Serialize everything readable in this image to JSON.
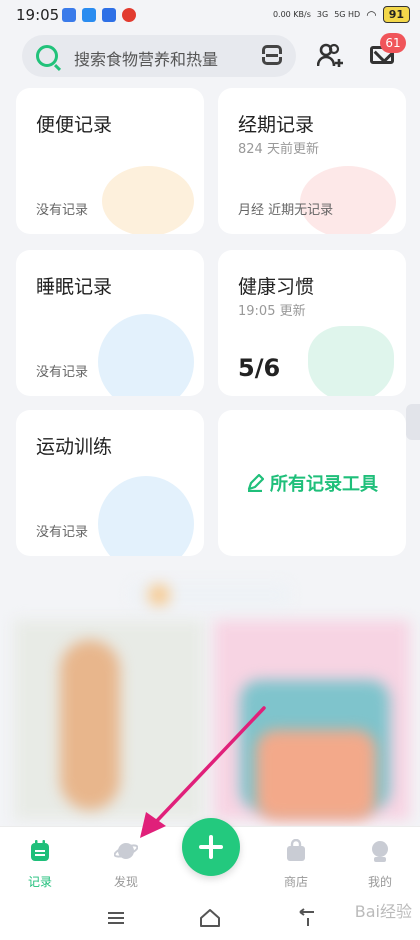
{
  "status": {
    "time": "19:05",
    "battery": "91",
    "net_speed": "0.00 KB/s",
    "signal_3g": "3G",
    "signal_5g": "5G HD"
  },
  "search": {
    "placeholder": "搜索食物营养和热量"
  },
  "mail_badge": "61",
  "cards": [
    {
      "title": "便便记录",
      "foot": "没有记录"
    },
    {
      "title": "经期记录",
      "subtitle": "824 天前更新",
      "foot": "月经 近期无记录"
    },
    {
      "title": "睡眠记录",
      "foot": "没有记录"
    },
    {
      "title": "健康习惯",
      "subtitle": "19:05 更新",
      "value": "5/6"
    },
    {
      "title": "运动训练",
      "foot": "没有记录"
    },
    {
      "title": "所有记录工具"
    }
  ],
  "tabs": [
    {
      "label": "记录",
      "icon": "notebook-icon"
    },
    {
      "label": "发现",
      "icon": "planet-icon"
    },
    {
      "label": "商店",
      "icon": "shop-bag-icon"
    },
    {
      "label": "我的",
      "icon": "profile-icon"
    }
  ],
  "watermark": "Bai经验",
  "colors": {
    "accent": "#1fbf7a",
    "badge": "#f0555a",
    "arrow": "#e0207a"
  }
}
